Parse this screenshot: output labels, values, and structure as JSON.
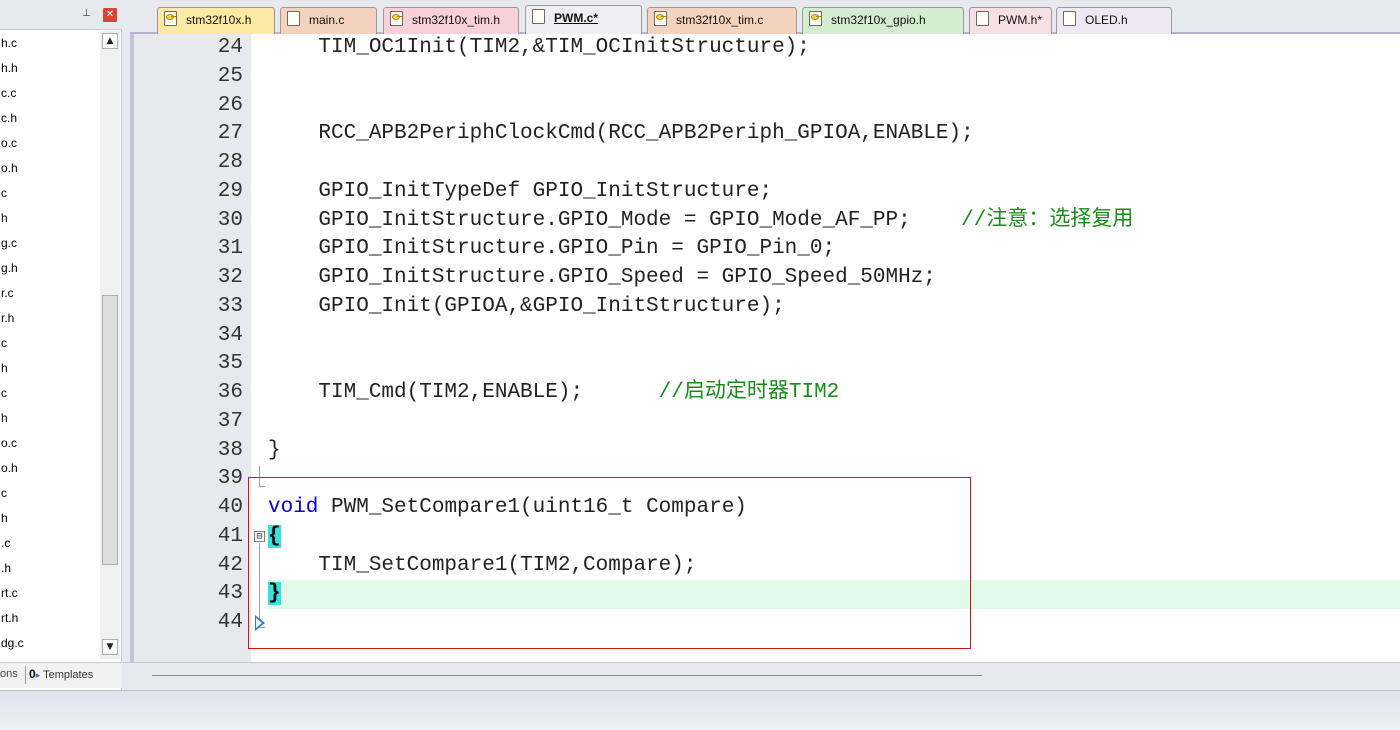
{
  "left_panel": {
    "pin_glyph": "⊥",
    "close_glyph": "✕",
    "files": [
      "h.c",
      "h.h",
      "c.c",
      "c.h",
      "o.c",
      "o.h",
      "c",
      "h",
      "g.c",
      "g.h",
      "r.c",
      "r.h",
      "c",
      "h",
      "c",
      "h",
      "o.c",
      "o.h",
      "c",
      "h",
      ".c",
      ".h",
      "rt.c",
      "rt.h",
      "dg.c"
    ],
    "bottom_tabs": {
      "functions": "ons",
      "templates": "Templates",
      "templates_icon": "0",
      "templates_arrow": "▸"
    },
    "scroll_up_glyph": "▲",
    "scroll_down_glyph": "▼"
  },
  "tabs": [
    {
      "label": "stm32f10x.h",
      "kind": "h-file",
      "icon": "key-file-icon"
    },
    {
      "label": "main.c",
      "kind": "c-file",
      "icon": "file-icon"
    },
    {
      "label": "stm32f10x_tim.h",
      "kind": "tim-h-file",
      "icon": "key-file-icon"
    },
    {
      "label": "PWM.c*",
      "kind": "active",
      "icon": "file-icon"
    },
    {
      "label": "stm32f10x_tim.c",
      "kind": "c-file",
      "icon": "key-file-icon"
    },
    {
      "label": "stm32f10x_gpio.h",
      "kind": "gpio-file",
      "icon": "key-file-icon"
    },
    {
      "label": "PWM.h*",
      "kind": "pwm-h-file",
      "icon": "file-icon"
    },
    {
      "label": "OLED.h",
      "kind": "oled-file",
      "icon": "file-icon"
    }
  ],
  "editor": {
    "lines": [
      {
        "num": "24",
        "code": "    TIM_OC1Init(TIM2,&TIM_OCInitStructure);",
        "comment": ""
      },
      {
        "num": "25",
        "code": "",
        "comment": ""
      },
      {
        "num": "26",
        "code": "",
        "comment": ""
      },
      {
        "num": "27",
        "code": "    RCC_APB2PeriphClockCmd(RCC_APB2Periph_GPIOA,ENABLE);",
        "comment": ""
      },
      {
        "num": "28",
        "code": "",
        "comment": ""
      },
      {
        "num": "29",
        "code": "    GPIO_InitTypeDef GPIO_InitStructure;",
        "comment": ""
      },
      {
        "num": "30",
        "code": "    GPIO_InitStructure.GPIO_Mode = GPIO_Mode_AF_PP;    ",
        "comment": "//注意：选择复用"
      },
      {
        "num": "31",
        "code": "    GPIO_InitStructure.GPIO_Pin = GPIO_Pin_0;",
        "comment": ""
      },
      {
        "num": "32",
        "code": "    GPIO_InitStructure.GPIO_Speed = GPIO_Speed_50MHz;",
        "comment": ""
      },
      {
        "num": "33",
        "code": "    GPIO_Init(GPIOA,&GPIO_InitStructure);",
        "comment": ""
      },
      {
        "num": "34",
        "code": "",
        "comment": ""
      },
      {
        "num": "35",
        "code": "",
        "comment": ""
      },
      {
        "num": "36",
        "code": "    TIM_Cmd(TIM2,ENABLE);      ",
        "comment": "//启动定时器TIM2"
      },
      {
        "num": "37",
        "code": "",
        "comment": ""
      },
      {
        "num": "38",
        "code": "}",
        "comment": ""
      },
      {
        "num": "39",
        "code": "",
        "comment": ""
      },
      {
        "num": "40",
        "keyword": "void",
        "code": " PWM_SetCompare1(uint16_t Compare)",
        "comment": ""
      },
      {
        "num": "41",
        "brace": "{",
        "code": "",
        "comment": ""
      },
      {
        "num": "42",
        "code": "    TIM_SetCompare1(TIM2,Compare);",
        "comment": ""
      },
      {
        "num": "43",
        "brace": "}",
        "code": "",
        "comment": "",
        "current": true
      },
      {
        "num": "44",
        "code": "",
        "comment": ""
      }
    ],
    "fold_toggle_glyph": "⊟",
    "colors": {
      "keyword": "#0a00d0",
      "comment": "#1a8a1a",
      "brace_highlight": "#38e0e0",
      "current_line": "#e2fbe9",
      "highlight_box": "#d01414"
    }
  }
}
